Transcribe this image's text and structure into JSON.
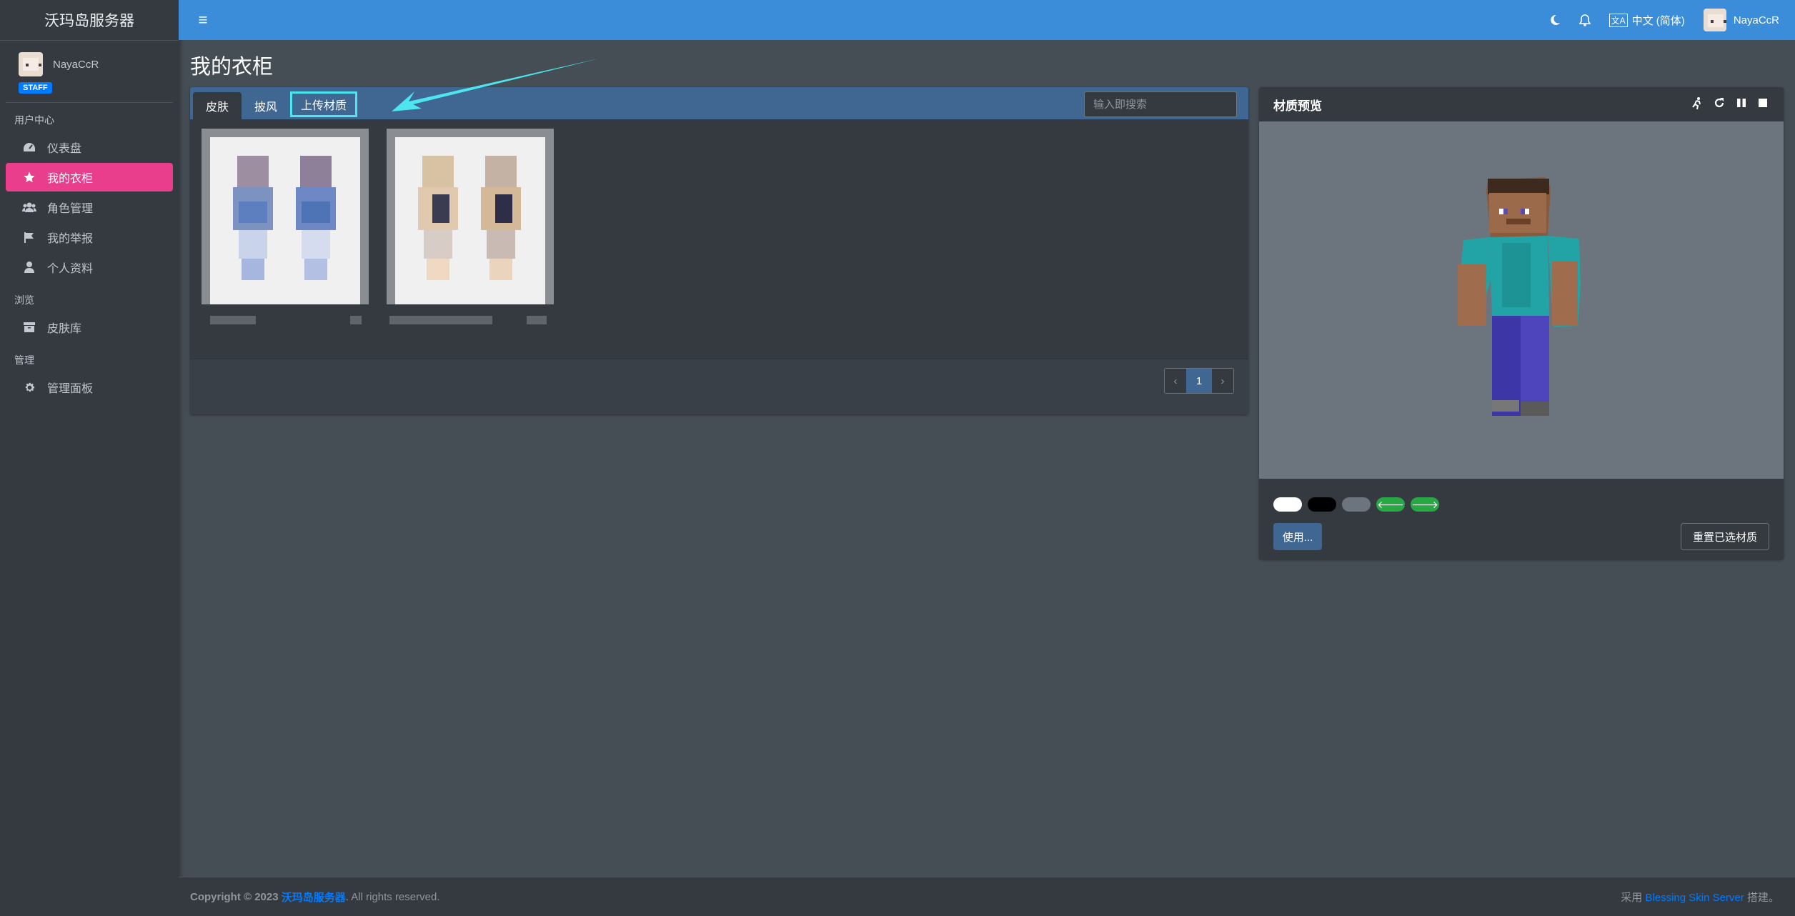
{
  "sidebar": {
    "brand": "沃玛岛服务器",
    "user_name": "NayaCcR",
    "badge": "STAFF",
    "section_user": "用户中心",
    "section_browse": "浏览",
    "section_admin": "管理",
    "items": [
      {
        "label": "仪表盘",
        "icon": "dashboard-icon"
      },
      {
        "label": "我的衣柜",
        "icon": "star-icon"
      },
      {
        "label": "角色管理",
        "icon": "users-icon"
      },
      {
        "label": "我的举报",
        "icon": "flag-icon"
      },
      {
        "label": "个人资料",
        "icon": "user-icon"
      },
      {
        "label": "皮肤库",
        "icon": "archive-icon"
      },
      {
        "label": "管理面板",
        "icon": "gear-icon"
      }
    ]
  },
  "topbar": {
    "language": "中文 (简体)",
    "user_name": "NayaCcR"
  },
  "main": {
    "title": "我的衣柜",
    "tabs": [
      "皮肤",
      "披风",
      "上传材质"
    ],
    "search_placeholder": "输入即搜索",
    "pagination": {
      "current": "1",
      "prev": "‹",
      "next": "›"
    }
  },
  "preview": {
    "title": "材质预览",
    "use_label": "使用...",
    "reset_label": "重置已选材质",
    "swatches": [
      {
        "color": "#ffffff",
        "icon": ""
      },
      {
        "color": "#000000",
        "icon": ""
      },
      {
        "color": "#6c757d",
        "icon": ""
      },
      {
        "color": "#28a745",
        "icon": "arrow-left-icon"
      },
      {
        "color": "#28a745",
        "icon": "arrow-right-icon"
      }
    ]
  },
  "footer": {
    "copyright_prefix": "Copyright © 2023",
    "copyright_site": "沃玛岛服务器",
    "copyright_suffix": ". All rights reserved.",
    "powered_prefix": "采用",
    "powered_link": "Blessing Skin Server",
    "powered_suffix": "搭建。"
  },
  "colors": {
    "accent": "#3c8dd9",
    "active_nav": "#e83e8c",
    "annotation": "#4de6f0"
  }
}
